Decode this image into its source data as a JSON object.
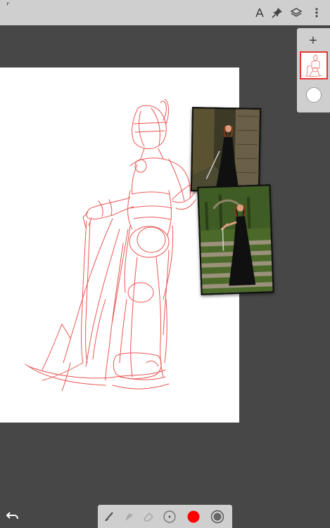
{
  "topbar": {
    "corner_mark": "⌜",
    "icons": [
      "ruler-icon",
      "pin-icon",
      "layers-icon",
      "more-vert-icon"
    ]
  },
  "layers": {
    "add_label": "+",
    "selected_layer_color": "#e53935"
  },
  "toolbar": {
    "tools": [
      "brush-icon",
      "smudge-icon",
      "eraser-icon",
      "brush-size-icon",
      "color-swatch",
      "opacity-icon"
    ],
    "current_color": "#ff0000"
  },
  "colors": {
    "background": "#474747",
    "bars": "#cfcfcf",
    "sketch_stroke": "#e53935"
  }
}
